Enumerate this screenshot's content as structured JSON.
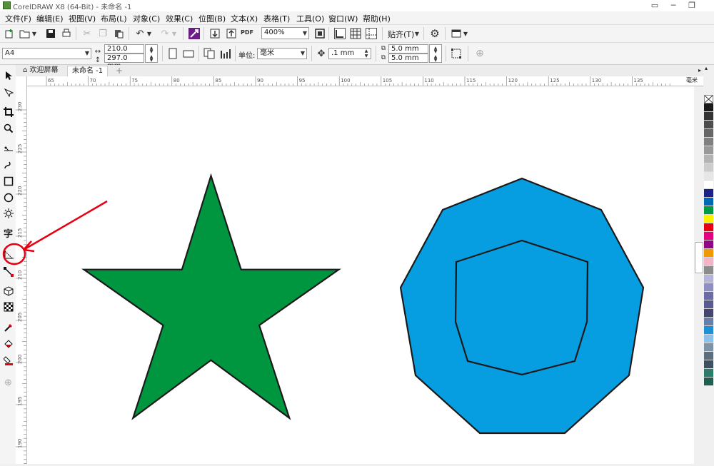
{
  "window": {
    "title": "CorelDRAW X8 (64-Bit) - 未命名 -1",
    "controls": [
      "▭",
      "─",
      "❐"
    ]
  },
  "menu": [
    "文件(F)",
    "编辑(E)",
    "视图(V)",
    "布局(L)",
    "对象(C)",
    "效果(C)",
    "位图(B)",
    "文本(X)",
    "表格(T)",
    "工具(O)",
    "窗口(W)",
    "帮助(H)"
  ],
  "toolbar": {
    "zoom": "400%",
    "snap_label": "贴齐(T)",
    "pdf_label": "PDF"
  },
  "property_bar": {
    "page_size": "A4",
    "width": "210.0 mm",
    "height": "297.0 mm",
    "unit_label": "单位:",
    "unit_value": "毫米",
    "nudge": ".1 mm",
    "dup_x": "5.0 mm",
    "dup_y": "5.0 mm"
  },
  "tabs": [
    {
      "label": "欢迎屏幕",
      "active": false
    },
    {
      "label": "未命名 -1",
      "active": true
    }
  ],
  "rulers": {
    "horizontal": [
      "65",
      "70",
      "75",
      "80",
      "85",
      "90",
      "95",
      "100",
      "105",
      "110",
      "115",
      "120",
      "125",
      "130",
      "135"
    ],
    "unit": "毫米",
    "vertical": [
      "230",
      "225",
      "220",
      "215",
      "210",
      "205",
      "200",
      "195",
      "190"
    ]
  },
  "toolbox": {
    "tools": [
      "pick-tool",
      "shape-tool",
      "crop-tool",
      "zoom-tool",
      "freehand-tool",
      "artistic-media-tool",
      "rectangle-tool",
      "ellipse-tool",
      "polygon-tool",
      "text-tool",
      "parallel-dimension-tool",
      "connector-tool",
      "blend-tool",
      "transparency-tool",
      "eyedropper-tool",
      "interactive-fill-tool",
      "smart-fill-tool",
      "add-tool"
    ],
    "highlighted": "parallel-dimension-tool",
    "text_tool_glyph": "字"
  },
  "canvas": {
    "shapes": [
      {
        "name": "green-star",
        "points": 5,
        "fill": "#009640"
      },
      {
        "name": "blue-star",
        "points": 9,
        "fill": "#069ee1"
      }
    ],
    "annotation_color": "#e60012"
  },
  "palette": [
    "none",
    "#1a1a1a",
    "#333333",
    "#4d4d4d",
    "#666666",
    "#808080",
    "#999999",
    "#b3b3b3",
    "#cccccc",
    "#e6e6e6",
    "#ffffff",
    "#1d2088",
    "#0068b7",
    "#009944",
    "#fff100",
    "#e60012",
    "#e4007f",
    "#920783",
    "#f39800",
    "#f4b4c4",
    "#8c8c8c",
    "#b5b5d6",
    "#8f8fc6",
    "#6b6ba8",
    "#5a5a8e",
    "#45456f",
    "#6a7fa8",
    "#1e90d8",
    "#8fc1e8",
    "#7c93a8",
    "#5a6e7e",
    "#3c5060",
    "#2b7c6b",
    "#1f5e50"
  ]
}
